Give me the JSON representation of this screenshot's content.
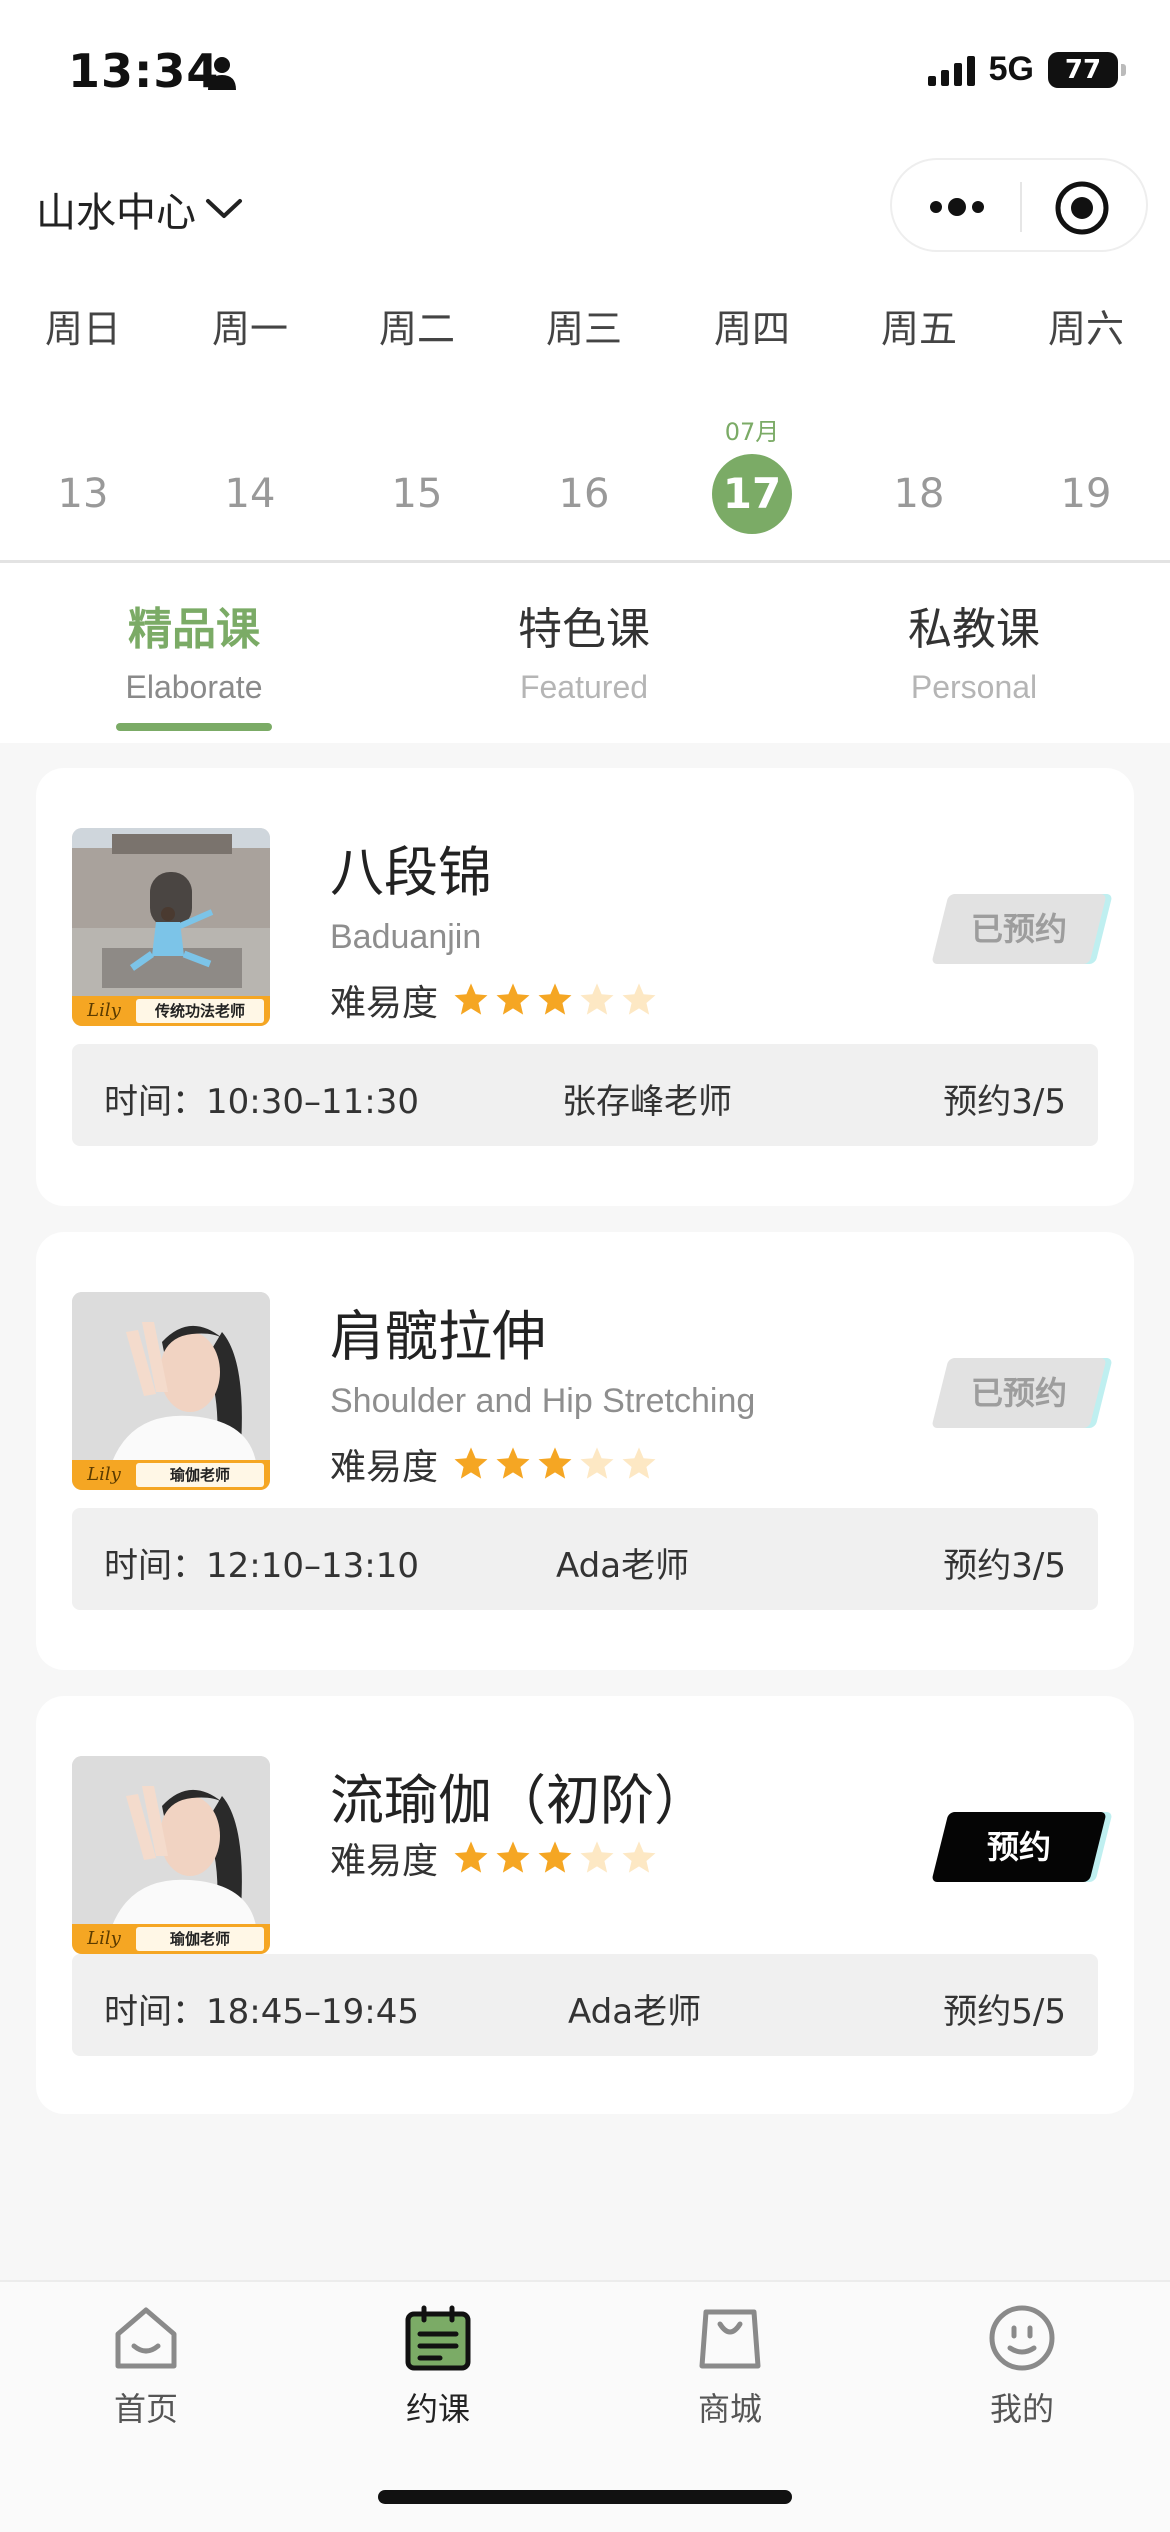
{
  "status_bar": {
    "time": "13:34",
    "network": "5G",
    "battery": "77"
  },
  "header": {
    "center_name": "山水中心"
  },
  "week": {
    "days": [
      "周日",
      "周一",
      "周二",
      "周三",
      "周四",
      "周五",
      "周六"
    ],
    "dates": [
      "13",
      "14",
      "15",
      "16",
      "17",
      "18",
      "19"
    ],
    "month_label": "07月",
    "selected_index": 4
  },
  "category_tabs": [
    {
      "title": "精品课",
      "subtitle": "Elaborate"
    },
    {
      "title": "特色课",
      "subtitle": "Featured"
    },
    {
      "title": "私教课",
      "subtitle": "Personal"
    }
  ],
  "courses": [
    {
      "title": "八段锦",
      "subtitle": "Baduanjin",
      "difficulty_label": "难易度",
      "difficulty_rating": 3,
      "difficulty_max": 5,
      "thumb_logo": "Lily",
      "thumb_tag": "传统功法老师",
      "time": "时间：10:30–11:30",
      "teacher": "张存峰老师",
      "count": "预约3/5",
      "button": "已预约",
      "button_state": "booked"
    },
    {
      "title": "肩髋拉伸",
      "subtitle": "Shoulder and Hip Stretching",
      "difficulty_label": "难易度",
      "difficulty_rating": 3,
      "difficulty_max": 5,
      "thumb_logo": "Lily",
      "thumb_tag": "瑜伽老师",
      "time": "时间：12:10–13:10",
      "teacher": "Ada老师",
      "count": "预约3/5",
      "button": "已预约",
      "button_state": "booked"
    },
    {
      "title": "流瑜伽（初阶）",
      "subtitle": "",
      "difficulty_label": "难易度",
      "difficulty_rating": 3,
      "difficulty_max": 5,
      "thumb_logo": "Lily",
      "thumb_tag": "瑜伽老师",
      "time": "时间：18:45–19:45",
      "teacher": "Ada老师",
      "count": "预约5/5",
      "button": "预约",
      "button_state": "open"
    }
  ],
  "tabbar": [
    {
      "label": "首页",
      "icon": "home-icon"
    },
    {
      "label": "约课",
      "icon": "calendar-icon"
    },
    {
      "label": "商城",
      "icon": "shopping-bag-icon"
    },
    {
      "label": "我的",
      "icon": "profile-icon"
    }
  ],
  "colors": {
    "accent": "#7bab66",
    "star": "#f5a623",
    "star_empty": "#fde8c4"
  }
}
